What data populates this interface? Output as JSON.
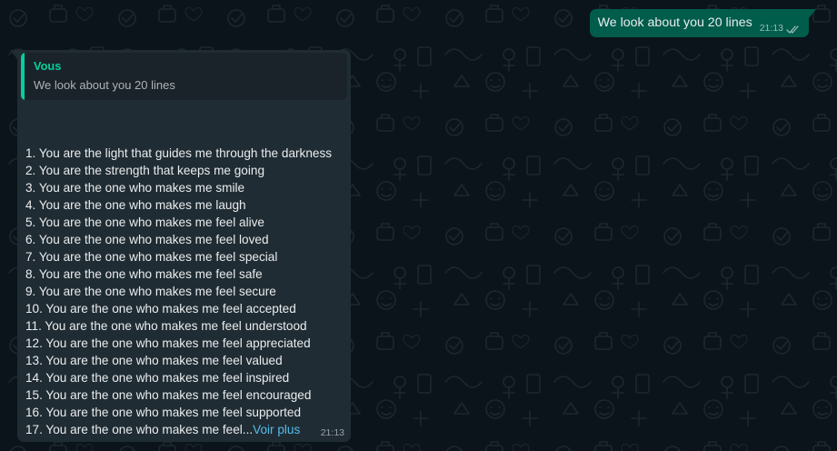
{
  "outgoing": {
    "text": "We look about you 20 lines",
    "time": "21:13",
    "status_icon": "double-check-icon"
  },
  "incoming": {
    "quote": {
      "author": "Vous",
      "text": "We look about you 20 lines"
    },
    "lines": [
      "1. You are the light that guides me through the darkness",
      "2. You are the strength that keeps me going",
      "3. You are the one who makes me smile",
      "4. You are the one who makes me laugh",
      "5. You are the one who makes me feel alive",
      "6. You are the one who makes me feel loved",
      "7. You are the one who makes me feel special",
      "8. You are the one who makes me feel safe",
      "9. You are the one who makes me feel secure",
      "10. You are the one who makes me feel accepted",
      "11. You are the one who makes me feel understood",
      "12. You are the one who makes me feel appreciated",
      "13. You are the one who makes me feel valued",
      "14. You are the one who makes me feel inspired",
      "15. You are the one who makes me feel encouraged",
      "16. You are the one who makes me feel supported"
    ],
    "last_line": "17. You are the one who makes me feel...",
    "see_more": "Voir plus",
    "time": "21:13"
  },
  "colors": {
    "background": "#0b141a",
    "outgoing_bubble": "#005c4b",
    "incoming_bubble": "#202c33",
    "quote_accent": "#06cf9c",
    "link": "#53bdeb"
  }
}
